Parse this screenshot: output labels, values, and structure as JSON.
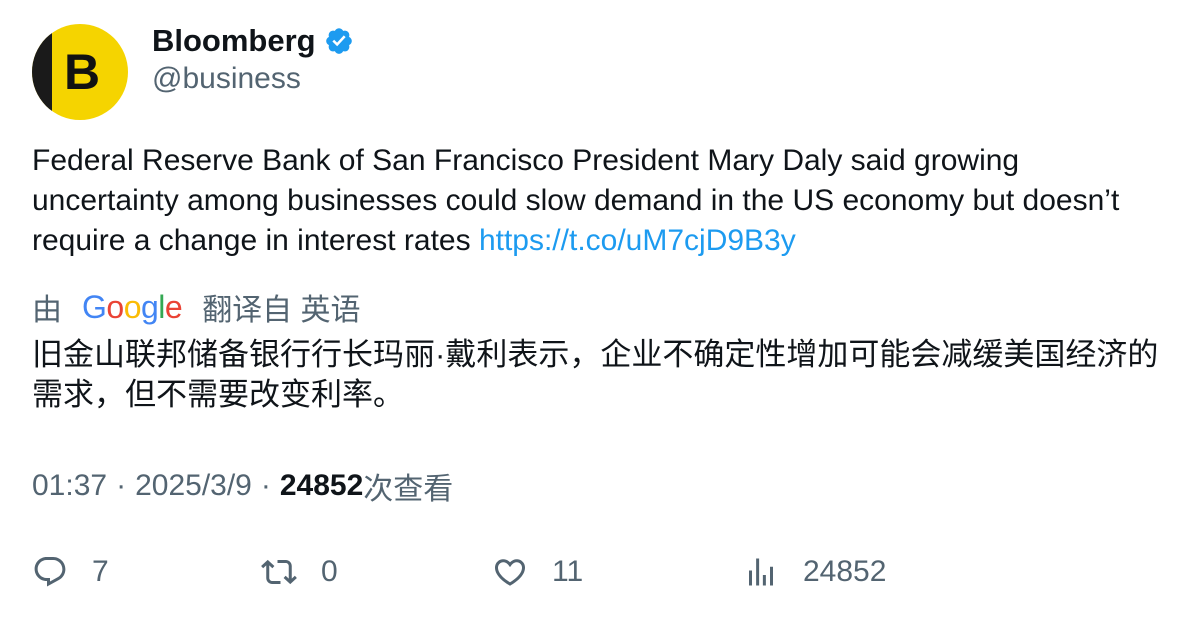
{
  "author": {
    "display_name": "Bloomberg",
    "handle": "@business",
    "avatar_letter": "B",
    "verified": true
  },
  "tweet": {
    "text": "Federal Reserve Bank of San Francisco President Mary Daly said growing uncertainty among businesses could slow demand in the US economy but doesn’t require a change in interest rates ",
    "link": "https://t.co/uM7cjD9B3y"
  },
  "translation": {
    "by_label": "由",
    "provider_letters": [
      "G",
      "o",
      "o",
      "g",
      "l",
      "e"
    ],
    "from_label": "翻译自 英语",
    "text": "旧金山联邦储备银行行长玛丽·戴利表示，企业不确定性增加可能会减缓美国经济的需求，但不需要改变利率。"
  },
  "meta": {
    "time": "01:37",
    "separator": "·",
    "date": "2025/3/9",
    "views_count": "24852",
    "views_label": "次查看"
  },
  "actions": {
    "replies": "7",
    "retweets": "0",
    "likes": "11",
    "views": "24852"
  },
  "colors": {
    "link": "#1d9bf0",
    "verified": "#1d9bf0",
    "secondary_text": "#536471",
    "primary_text": "#0f1419",
    "avatar_yellow": "#f5d400"
  },
  "icons": {
    "reply": "reply-icon",
    "retweet": "retweet-icon",
    "like": "heart-icon",
    "views": "views-chart-icon",
    "verified": "verified-badge-icon"
  }
}
